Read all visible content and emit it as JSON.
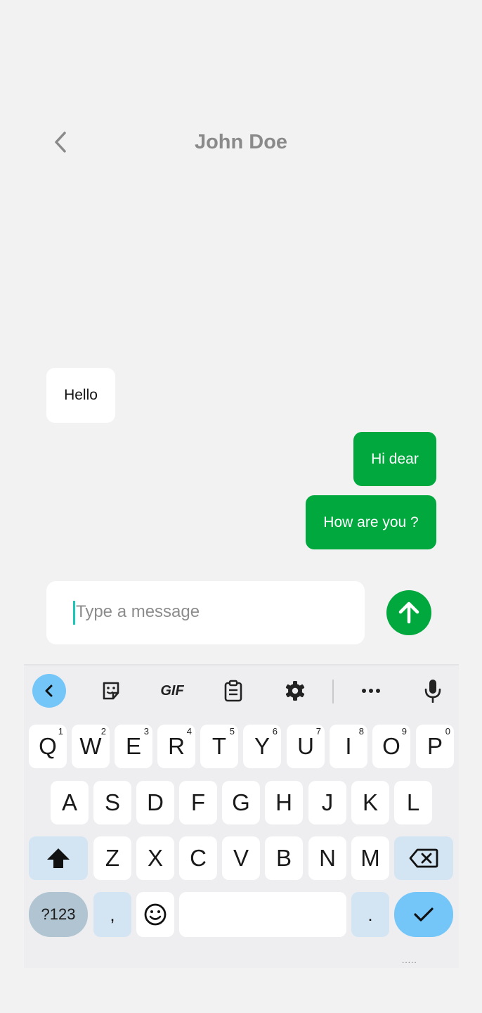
{
  "header": {
    "title": "John Doe",
    "back_icon": "chevron-left-icon"
  },
  "messages": [
    {
      "text": "Hello",
      "direction": "incoming"
    },
    {
      "text": "Hi dear",
      "direction": "outgoing"
    },
    {
      "text": "How are you ?",
      "direction": "outgoing"
    }
  ],
  "composer": {
    "placeholder": "Type a message",
    "send_icon": "arrow-up-icon"
  },
  "keyboard": {
    "toolbar": [
      "chevron-left-icon",
      "sticker-icon",
      "gif-icon",
      "clipboard-icon",
      "gear-icon",
      "more-icon",
      "microphone-icon"
    ],
    "gif_label": "GIF",
    "row1": [
      {
        "label": "Q",
        "hint": "1"
      },
      {
        "label": "W",
        "hint": "2"
      },
      {
        "label": "E",
        "hint": "3"
      },
      {
        "label": "R",
        "hint": "4"
      },
      {
        "label": "T",
        "hint": "5"
      },
      {
        "label": "Y",
        "hint": "6"
      },
      {
        "label": "U",
        "hint": "7"
      },
      {
        "label": "I",
        "hint": "8"
      },
      {
        "label": "O",
        "hint": "9"
      },
      {
        "label": "P",
        "hint": "0"
      }
    ],
    "row2": [
      "A",
      "S",
      "D",
      "F",
      "G",
      "H",
      "J",
      "K",
      "L"
    ],
    "row3": [
      "Z",
      "X",
      "C",
      "V",
      "B",
      "N",
      "M"
    ],
    "symbols_label": "?123",
    "comma_label": ",",
    "period_label": ".",
    "bottom_hint": ".....",
    "colors": {
      "send": "#00a83e",
      "accent": "#74c6f8",
      "modifier": "#d3e4f2"
    }
  }
}
